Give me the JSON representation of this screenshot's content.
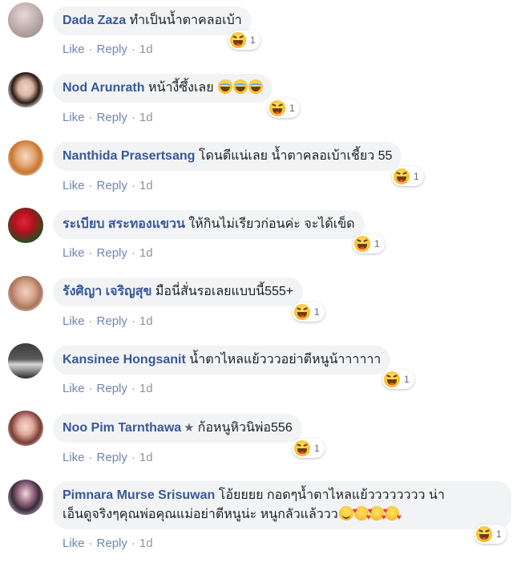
{
  "actions": {
    "like": "Like",
    "reply": "Reply",
    "sep": "·"
  },
  "comments": [
    {
      "name": "Dada Zaza",
      "text": "ทำเป็นน้ำตาคลอเบ้า",
      "time": "1d",
      "reaction_count": "1",
      "reaction": "haha-icon"
    },
    {
      "name": "Nod Arunrath",
      "text": "หน้างี้ซึ้งเลย",
      "emoji_suffix": [
        "laugh-tears-emoji",
        "laugh-tears-emoji",
        "laugh-tears-emoji"
      ],
      "time": "1d",
      "reaction_count": "1",
      "reaction": "haha-icon"
    },
    {
      "name": "Nanthida Prasertsang",
      "text": "โดนตีแน่เลย น้ำตาคลอเบ้าเชี้ยว 55",
      "time": "1d",
      "reaction_count": "1",
      "reaction": "haha-icon"
    },
    {
      "name": "ระเบียบ สระทองแขวน",
      "text": "ให้กินไม่เรียวก่อนค่ะ จะได้เข็ด",
      "time": "1d",
      "reaction_count": "1",
      "reaction": "haha-icon"
    },
    {
      "name": "รังศิญา เจริญสุข",
      "text": "มือนี่สั่นรอเลยแบบนี้555+",
      "time": "1d",
      "reaction_count": "1",
      "reaction": "haha-icon"
    },
    {
      "name": "Kansinee Hongsanit",
      "text": "น้ำตาไหลแย้วววอย่าตีหนูน้าาาาาา",
      "time": "1d",
      "reaction_count": "1",
      "reaction": "haha-icon"
    },
    {
      "name": "Noo Pim Tarnthawa",
      "badge": "★",
      "text": "ก้อหนูหิวนิพ่อ556",
      "time": "1d",
      "reaction_count": "1",
      "reaction": "haha-icon"
    },
    {
      "name": "Pimnara Murse Srisuwan",
      "text": "โอ้ยยยย กอดๆน้ำตาไหลแย้วววววววว น่า",
      "text2": "เอ็นดูจริงๆคุณพ่อคุณแม่อย่าตีหนูน่ะ หนูกลัวแล้ววว",
      "emoji_suffix": [
        "wink-emoji",
        "heart-eyes-emoji",
        "heart-eyes-emoji",
        "heart-eyes-emoji"
      ],
      "time": "1d",
      "reaction_count": "1",
      "reaction": "haha-icon"
    }
  ]
}
